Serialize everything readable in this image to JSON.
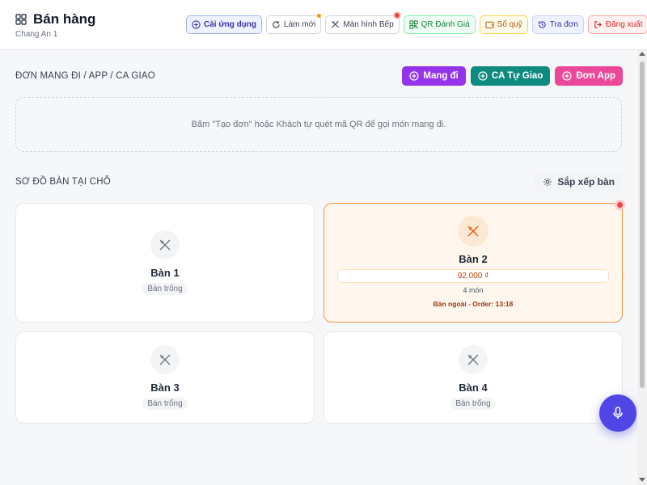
{
  "header": {
    "title": "Bán hàng",
    "subtitle": "Chang An 1",
    "toolbar": {
      "install": "Cài ứng dụng",
      "refresh": "Làm mới",
      "kitchen": "Màn hình Bếp",
      "qr_review": "QR Đánh Giá",
      "cashbook": "Sổ quỹ",
      "lookup": "Tra đơn",
      "logout": "Đăng xuất"
    }
  },
  "takeaway": {
    "title": "ĐƠN MANG ĐI / APP / CA GIAO",
    "buttons": {
      "takeaway": "Mang đi",
      "ca_delivery": "CA Tự Giao",
      "app_order": "Đơn App"
    },
    "empty_message": "Bấm \"Tạo đơn\" hoặc Khách tự quét mã QR để gọi món mang đi."
  },
  "floor": {
    "title": "SƠ ĐỒ BÀN TẠI CHỖ",
    "arrange_label": "Sắp xếp bàn",
    "tables": [
      {
        "name": "Bàn 1",
        "status": "Bàn trống"
      },
      {
        "name": "Bàn 2",
        "amount": "92.000 ₫",
        "items": "4 món",
        "order_info": "Bàn ngoài - Order: 13:18"
      },
      {
        "name": "Bàn 3",
        "status": "Bàn trống"
      },
      {
        "name": "Bàn 4",
        "status": "Bàn trống"
      }
    ]
  },
  "colors": {
    "accent": "#4f46e5",
    "takeaway": "#9333ea",
    "ca_delivery": "#0f8a7e",
    "app_order": "#ec4899",
    "occupied": "#fb923c"
  }
}
